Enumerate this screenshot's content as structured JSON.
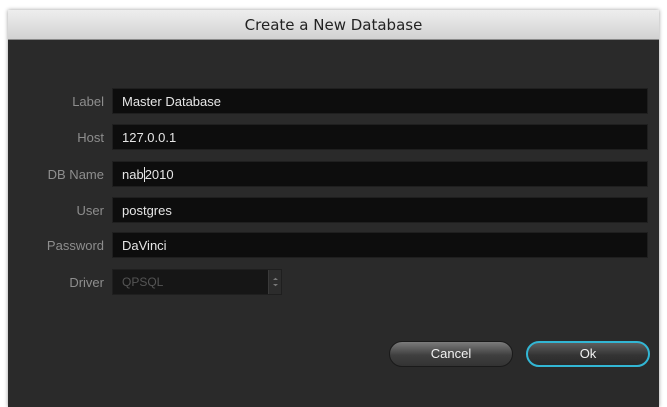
{
  "dialog": {
    "title": "Create a New Database",
    "fields": [
      {
        "label": "Label",
        "value": "Master Database"
      },
      {
        "label": "Host",
        "value": "127.0.0.1"
      },
      {
        "label": "DB Name",
        "value_before_caret": "nab",
        "value_after_caret": "2010"
      },
      {
        "label": "User",
        "value": "postgres"
      },
      {
        "label": "Password",
        "value": "DaVinci"
      }
    ],
    "driver": {
      "label": "Driver",
      "value": "QPSQL"
    },
    "buttons": {
      "cancel": "Cancel",
      "ok": "Ok"
    }
  },
  "colors": {
    "background": "#2a2a2a",
    "field": "#0d0d0d",
    "label": "#8e8e8e",
    "ok_border": "#32b6d4"
  },
  "icons": {
    "driver_dropdown": "chevron-down-icon"
  }
}
